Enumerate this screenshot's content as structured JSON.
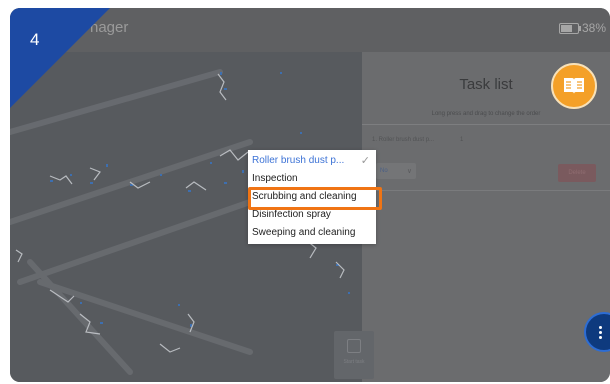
{
  "step": {
    "number": "4"
  },
  "app": {
    "title": "nager"
  },
  "status": {
    "battery": "38%"
  },
  "panel": {
    "title": "Task list",
    "hint": "Long press and drag to change the order",
    "task_row": "1.  Roller brush dust p...",
    "task_count": "1",
    "mode_value": "No",
    "delete_label": "Delete"
  },
  "start_button": {
    "label": "Start task"
  },
  "dropdown": {
    "options": [
      {
        "label": "Roller brush dust p...",
        "selected": true
      },
      {
        "label": "Inspection"
      },
      {
        "label": "Scrubbing and cleaning",
        "highlighted": true
      },
      {
        "label": "Disinfection spray"
      },
      {
        "label": "Sweeping and cleaning"
      }
    ]
  },
  "colors": {
    "badge": "#1d4aa3",
    "highlight": "#f07414",
    "book_button": "#f4a028",
    "fab": "#0e3a7e",
    "selected_text": "#3d73d6"
  },
  "icons": [
    "book-icon",
    "check-icon",
    "battery-icon",
    "menu-icon",
    "start-task-icon"
  ]
}
